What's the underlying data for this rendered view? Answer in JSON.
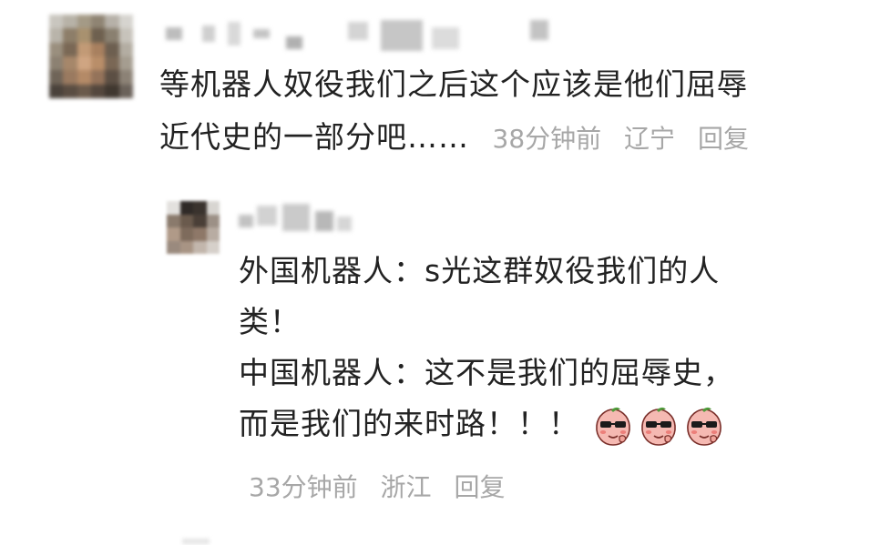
{
  "comment": {
    "text_line1": "等机器人奴役我们之后这个应该是他们屈辱",
    "text_line2": "近代史的一部分吧……",
    "time": "38分钟前",
    "location": "辽宁",
    "reply_label": "回复"
  },
  "reply": {
    "line1": "外国机器人：s光这群奴役我们的人",
    "line2": "类！",
    "line3": "中国机器人：这不是我们的屈辱史，",
    "line4": "而是我们的来时路！！！",
    "emoji_icons": [
      "cool-peach-emoji",
      "cool-peach-emoji",
      "cool-peach-emoji"
    ],
    "time": "33分钟前",
    "location": "浙江",
    "reply_label": "回复"
  },
  "colors": {
    "text": "#222222",
    "meta": "#a7a7a7",
    "background": "#ffffff"
  }
}
